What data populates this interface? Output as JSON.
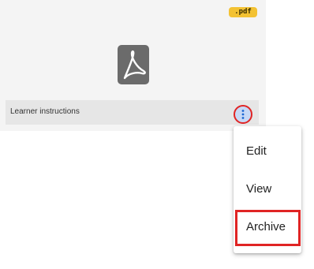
{
  "card": {
    "badge": ".pdf",
    "icon": "pdf-file-icon",
    "title": "Learner instructions",
    "menu_icon": "kebab-vertical-icon"
  },
  "menu": {
    "items": [
      {
        "label": "Edit"
      },
      {
        "label": "View"
      },
      {
        "label": "Archive"
      }
    ]
  },
  "colors": {
    "badge_bg": "#f3c233",
    "highlight": "#e02424",
    "icon_gray": "#6b6b6b",
    "kebab_bg": "#c7d9f6",
    "kebab_dots": "#1a66d2"
  }
}
